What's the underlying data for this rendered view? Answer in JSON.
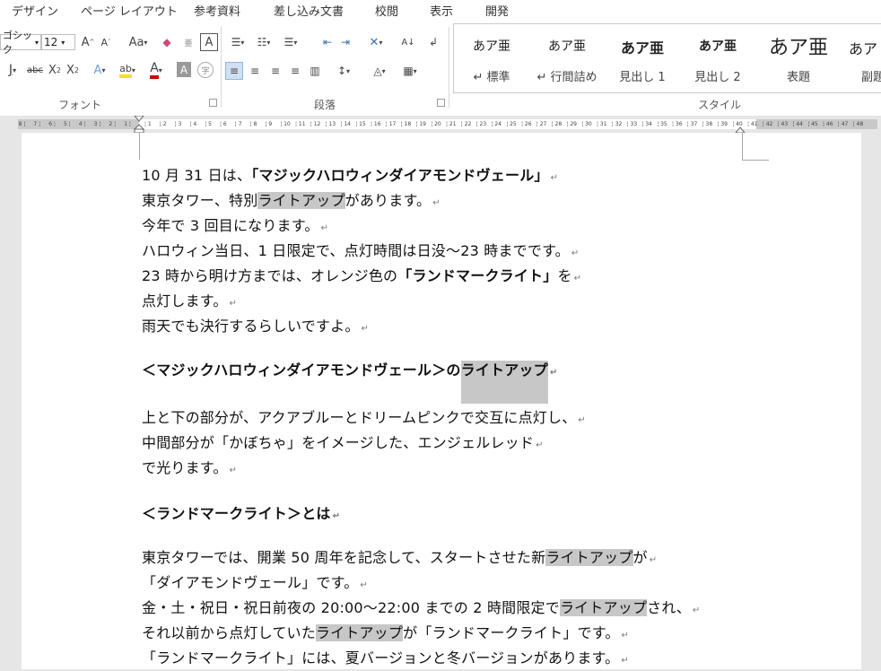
{
  "tabs": [
    "デザイン",
    "ページ レイアウト",
    "参考資料",
    "差し込み文書",
    "校閲",
    "表示",
    "開発"
  ],
  "ribbon": {
    "font_name": "ゴシック",
    "font_size": "12",
    "font_group_label": "フォント",
    "paragraph_group_label": "段落",
    "styles_group_label": "スタイル",
    "styles": [
      {
        "sample": "あア亜",
        "name": "↵ 標準"
      },
      {
        "sample": "あア亜",
        "name": "↵ 行間詰め"
      },
      {
        "sample": "あア亜",
        "name": "見出し 1"
      },
      {
        "sample": "あア亜",
        "name": "見出し 2"
      },
      {
        "sample": "あア亜",
        "name": "表題"
      },
      {
        "sample": "あア",
        "name": "副題"
      }
    ]
  },
  "ruler": {
    "left_ticks": [
      "8",
      "7",
      "6",
      "5",
      "4",
      "3",
      "2",
      "1"
    ],
    "right_ticks": [
      "1",
      "2",
      "3",
      "4",
      "5",
      "6",
      "7",
      "8",
      "9",
      "10",
      "11",
      "12",
      "13",
      "14",
      "15",
      "16",
      "17",
      "18",
      "19",
      "20",
      "21",
      "22",
      "23",
      "24",
      "25",
      "26",
      "27",
      "28",
      "29",
      "30",
      "31",
      "32",
      "33",
      "34",
      "35",
      "36",
      "37",
      "38",
      "39",
      "40",
      "41",
      "42",
      "43",
      "44",
      "45",
      "46",
      "47",
      "48"
    ]
  },
  "doc": {
    "p1a": "10 月 31 日は、",
    "p1b": "「マジックハロウィンダイアモンドヴェール」",
    "p2a": "東京タワー、特別",
    "hl": "ライトアップ",
    "p2b": "があります。",
    "p3": "今年で 3 回目になります。",
    "p4": "ハロウィン当日、1 日限定で、点灯時間は日没～23 時までです。",
    "p5a": "23 時から明け方までは、オレンジ色の",
    "p5b": "「ランドマークライト」",
    "p5c": "を",
    "p6": "点灯します。",
    "p7": "雨天でも決行するらしいですよ。",
    "h1a": "＜マジックハロウィンダイアモンドヴェール＞の",
    "p8": "上と下の部分が、アクアブルーとドリームピンクで交互に点灯し、",
    "p9": "中間部分が「かぼちゃ」をイメージした、エンジェルレッド",
    "p10": "で光ります。",
    "h2": "＜ランドマークライト＞とは",
    "p11a": "東京タワーでは、開業 50 周年を記念して、スタートさせた新",
    "p11b": "が",
    "p12": "「ダイアモンドヴェール」です。",
    "p13a": "金・土・祝日・祝日前夜の 20:00～22:00 までの 2 時間限定で",
    "p13b": "され、",
    "p14a": "それ以前から点灯していた",
    "p14b": "が「ランドマークライト」です。",
    "p15": "「ランドマークライト」には、夏バージョンと冬バージョンがあります。"
  }
}
